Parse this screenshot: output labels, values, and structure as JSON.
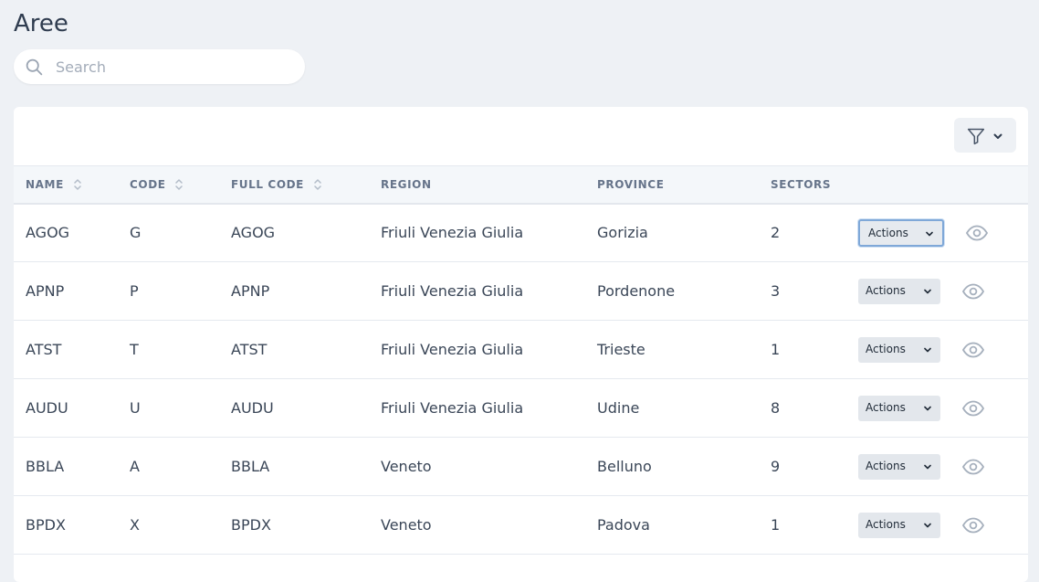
{
  "page": {
    "title": "Aree"
  },
  "search": {
    "placeholder": "Search",
    "value": ""
  },
  "table": {
    "columns": {
      "name": "NAME",
      "code": "CODE",
      "full_code": "FULL CODE",
      "region": "REGION",
      "province": "PROVINCE",
      "sectors": "SECTORS"
    },
    "actions_label": "Actions",
    "rows": [
      {
        "name": "AGOG",
        "code": "G",
        "full_code": "AGOG",
        "region": "Friuli Venezia Giulia",
        "province": "Gorizia",
        "sectors": "2"
      },
      {
        "name": "APNP",
        "code": "P",
        "full_code": "APNP",
        "region": "Friuli Venezia Giulia",
        "province": "Pordenone",
        "sectors": "3"
      },
      {
        "name": "ATST",
        "code": "T",
        "full_code": "ATST",
        "region": "Friuli Venezia Giulia",
        "province": "Trieste",
        "sectors": "1"
      },
      {
        "name": "AUDU",
        "code": "U",
        "full_code": "AUDU",
        "region": "Friuli Venezia Giulia",
        "province": "Udine",
        "sectors": "8"
      },
      {
        "name": "BBLA",
        "code": "A",
        "full_code": "BBLA",
        "region": "Veneto",
        "province": "Belluno",
        "sectors": "9"
      },
      {
        "name": "BPDX",
        "code": "X",
        "full_code": "BPDX",
        "region": "Veneto",
        "province": "Padova",
        "sectors": "1"
      }
    ]
  },
  "icons": {
    "search": "search-icon",
    "filter": "filter-icon",
    "chevron": "chevron-down-icon",
    "sort": "sort-icon",
    "view": "eye-icon"
  },
  "colors": {
    "background": "#eef1f5",
    "card": "#ffffff",
    "header_row": "#f4f7fa",
    "focus_ring": "#7fa8d8"
  }
}
